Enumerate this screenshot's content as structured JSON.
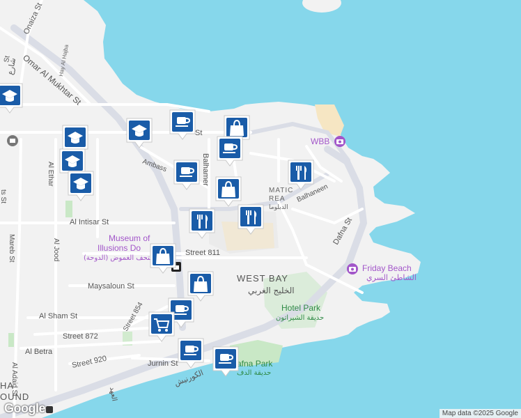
{
  "colors": {
    "water": "#86D7EB",
    "land": "#F2F2F2",
    "road": "#FFFFFF",
    "highway": "#DADDE6",
    "park": "#C9E8C6",
    "sand": "#F6E6C3",
    "marker_bg": "#1A5CA8",
    "poi_purple": "#A256C9",
    "park_green": "#2F8A45"
  },
  "roads": {
    "onaiza_st": "Onaiza St",
    "omar_al_mukhtar_st": "Omar Al Mukhtar St",
    "hay_al_hajba": "Hay Al Hajba",
    "al_ethar": "Al Ethar",
    "al_intisar_st": "Al Intisar St",
    "mareb_st": "Mareb St",
    "al_jood": "Al Jood",
    "maysaloun_st": "Maysaloun St",
    "al_sham_st": "Al Sham St",
    "street_872": "Street 872",
    "al_betra": "Al Betra",
    "street_920": "Street 920",
    "al_adaid_st": "Al Adaid St",
    "jurnin_st": "Jurnin St",
    "street_811": "Street 811",
    "street_854": "Street 854",
    "dafna_st": "Dafna St",
    "balhaneen": "Balhaneen",
    "balhamer": "Balhamer",
    "ambassador": "Ambass",
    "st_fragment": "St",
    "al_corniche_ar": "الكورنيش",
    "al_ahd_ar": "العهد",
    "left_edge_ar": "شارع",
    "left_edge_st": "St",
    "vertical_fragment": "ts St"
  },
  "areas": {
    "west_bay_en": "WEST BAY",
    "west_bay_ar": "الخليج الغربي",
    "diplomatic_en": "MATIC",
    "diplomatic_en2": "REA",
    "diplomatic_ar": "الدبلوما",
    "doha_fragment": "HA",
    "doha_fragment2": "OUND"
  },
  "pois": {
    "museum_en1": "Museum of",
    "museum_en2": "Illusions Do",
    "museum_ar": "متحف الغموض (الدوحة)",
    "wbb": "WBB",
    "friday_beach_en": "Friday Beach",
    "friday_beach_ar": "الشاطئ السري",
    "hotel_park_en": "Hotel Park",
    "hotel_park_ar": "حديقة الشيراتون",
    "dafna_park_en": "afna Park",
    "dafna_park_ar": "حديقة الدف"
  },
  "markers": [
    {
      "type": "school",
      "icon": "graduation-cap-icon"
    },
    {
      "type": "school",
      "icon": "graduation-cap-icon"
    },
    {
      "type": "school",
      "icon": "graduation-cap-icon"
    },
    {
      "type": "school",
      "icon": "graduation-cap-icon"
    },
    {
      "type": "school",
      "icon": "graduation-cap-icon"
    },
    {
      "type": "cafe",
      "icon": "coffee-cup-icon"
    },
    {
      "type": "shopping",
      "icon": "shopping-bag-icon"
    },
    {
      "type": "cafe",
      "icon": "coffee-cup-icon"
    },
    {
      "type": "cafe",
      "icon": "coffee-cup-icon"
    },
    {
      "type": "restaurant",
      "icon": "fork-knife-icon"
    },
    {
      "type": "restaurant",
      "icon": "fork-knife-icon"
    },
    {
      "type": "restaurant",
      "icon": "fork-knife-icon"
    },
    {
      "type": "shopping",
      "icon": "shopping-bag-icon"
    },
    {
      "type": "shopping",
      "icon": "shopping-bag-icon"
    },
    {
      "type": "shopping",
      "icon": "shopping-bag-icon"
    },
    {
      "type": "cafe",
      "icon": "coffee-cup-icon"
    },
    {
      "type": "grocery",
      "icon": "shopping-cart-icon"
    },
    {
      "type": "cafe",
      "icon": "coffee-cup-icon"
    },
    {
      "type": "cafe",
      "icon": "coffee-cup-icon"
    }
  ],
  "attribution": "Map data ©2025 Google",
  "google_logo": "Google"
}
